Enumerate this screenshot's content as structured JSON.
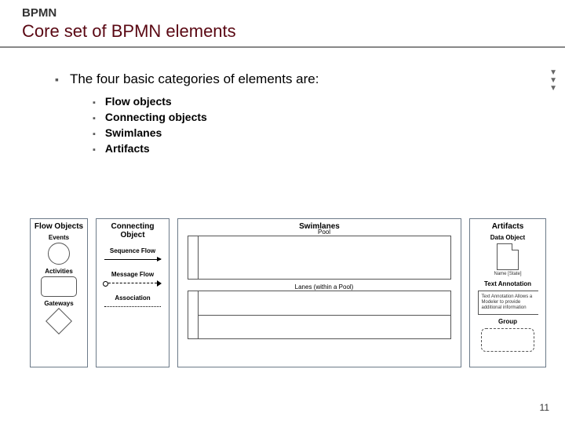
{
  "header": {
    "eyebrow": "BPMN",
    "title": "Core set of BPMN elements"
  },
  "intro": "The four basic categories of elements are:",
  "bullets": [
    "Flow objects",
    "Connecting objects",
    "Swimlanes",
    "Artifacts"
  ],
  "panels": {
    "flow": {
      "title": "Flow Objects",
      "events": "Events",
      "activities": "Activities",
      "gateways": "Gateways"
    },
    "conn": {
      "title": "Connecting Object",
      "seq": "Sequence Flow",
      "msg": "Message Flow",
      "assoc": "Association"
    },
    "swim": {
      "title": "Swimlanes",
      "pool": "Pool",
      "lanes": "Lanes (within a Pool)"
    },
    "art": {
      "title": "Artifacts",
      "data": "Data Object",
      "name": "Name [State]",
      "text": "Text Annotation",
      "textDesc": "Text Annotation Allows a Modeler to provide additional information",
      "group": "Group"
    }
  },
  "page": "11"
}
